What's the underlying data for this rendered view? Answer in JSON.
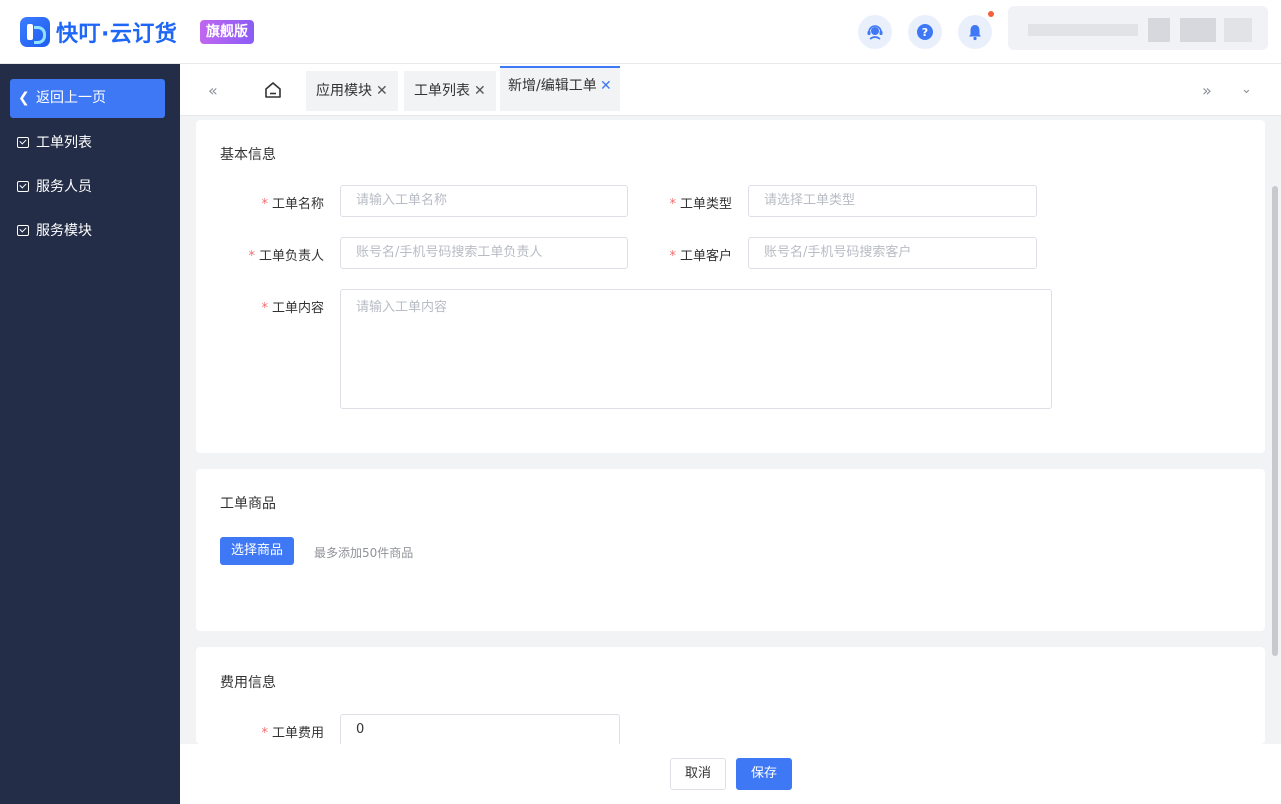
{
  "header": {
    "brand": "快叮·云订货",
    "edition_badge": "旗舰版",
    "icons": [
      "support-icon",
      "help-icon",
      "bell-icon"
    ]
  },
  "sidebar": {
    "back_label": "返回上一页",
    "items": [
      {
        "label": "工单列表"
      },
      {
        "label": "服务人员"
      },
      {
        "label": "服务模块"
      }
    ]
  },
  "tabs": [
    {
      "label": "应用模块",
      "active": false
    },
    {
      "label": "工单列表",
      "active": false
    },
    {
      "label": "新增/编辑工单",
      "active": true
    }
  ],
  "basic_info": {
    "title": "基本信息",
    "fields": {
      "name": {
        "label": "工单名称",
        "placeholder": "请输入工单名称"
      },
      "type": {
        "label": "工单类型",
        "placeholder": "请选择工单类型"
      },
      "owner": {
        "label": "工单负责人",
        "placeholder": "账号名/手机号码搜索工单负责人"
      },
      "customer": {
        "label": "工单客户",
        "placeholder": "账号名/手机号码搜索客户"
      },
      "content": {
        "label": "工单内容",
        "placeholder": "请输入工单内容"
      }
    }
  },
  "products": {
    "title": "工单商品",
    "select_button": "选择商品",
    "hint": "最多添加50件商品"
  },
  "fees": {
    "title": "费用信息",
    "fee_label": "工单费用",
    "fee_value": "0"
  },
  "footer": {
    "cancel_label": "取消",
    "save_label": "保存"
  },
  "colors": {
    "primary": "#3f78f5",
    "sidebar_bg": "#232d47",
    "required": "#f56c6c"
  }
}
